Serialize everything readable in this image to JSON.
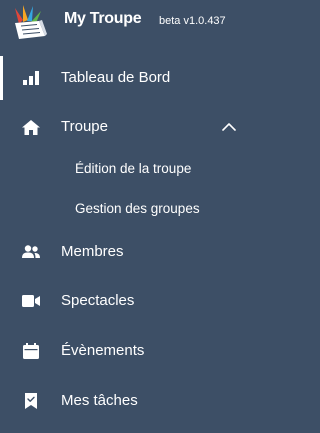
{
  "brand": {
    "app_name": "My Troupe",
    "version": "beta v1.0.437"
  },
  "nav": {
    "dashboard": {
      "label": "Tableau de Bord",
      "icon": "bar-chart-icon"
    },
    "troupe": {
      "label": "Troupe",
      "icon": "home-icon",
      "expanded": true,
      "children": [
        {
          "label": "Édition de la troupe"
        },
        {
          "label": "Gestion des groupes"
        }
      ]
    },
    "members": {
      "label": "Membres",
      "icon": "users-icon"
    },
    "shows": {
      "label": "Spectacles",
      "icon": "video-camera-icon"
    },
    "events": {
      "label": "Évènements",
      "icon": "calendar-icon"
    },
    "tasks": {
      "label": "Mes tâches",
      "icon": "bookmark-check-icon"
    }
  },
  "colors": {
    "sidebar_bg": "#3d4f66",
    "text": "#ffffff",
    "logo_colors": [
      "#e2463a",
      "#f6a623",
      "#35a6e0",
      "#62b54a"
    ]
  }
}
